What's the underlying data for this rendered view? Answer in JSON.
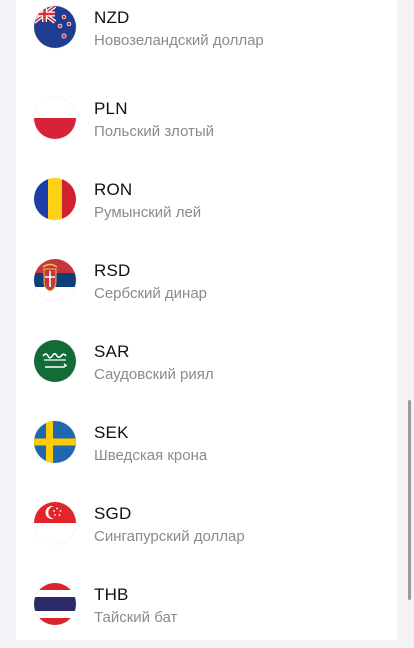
{
  "currencies": [
    {
      "code": "NZD",
      "name": "Новозеландский доллар",
      "flag_icon": "new-zealand-flag-icon"
    },
    {
      "code": "PLN",
      "name": "Польский злотый",
      "flag_icon": "poland-flag-icon"
    },
    {
      "code": "RON",
      "name": "Румынский лей",
      "flag_icon": "romania-flag-icon"
    },
    {
      "code": "RSD",
      "name": "Сербский динар",
      "flag_icon": "serbia-flag-icon"
    },
    {
      "code": "SAR",
      "name": "Саудовский риял",
      "flag_icon": "saudi-arabia-flag-icon"
    },
    {
      "code": "SEK",
      "name": "Шведская крона",
      "flag_icon": "sweden-flag-icon"
    },
    {
      "code": "SGD",
      "name": "Сингапурский доллар",
      "flag_icon": "singapore-flag-icon"
    },
    {
      "code": "THB",
      "name": "Тайский бат",
      "flag_icon": "thailand-flag-icon"
    }
  ],
  "colors": {
    "background": "#f2f2f7",
    "card": "#ffffff",
    "code_text": "#111111",
    "name_text": "#8a8a8f"
  }
}
